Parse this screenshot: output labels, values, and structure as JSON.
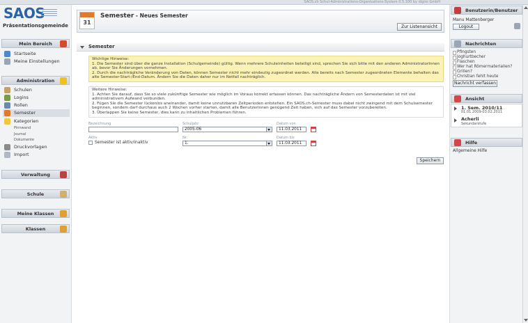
{
  "header": {
    "sysinfo": "SAOS.ch Schul-Administrations-Organisations-System 0.5.100 by digiro GmbH"
  },
  "logo": {
    "text": "SAOS",
    "school": "Präsentationsgemeinde"
  },
  "sidebar": {
    "mein_bereich": {
      "label": "Mein Bereich",
      "items": [
        "Startseite",
        "Meine Einstellungen"
      ]
    },
    "administration": {
      "label": "Administration",
      "items": [
        "Schulen",
        "Logins",
        "Rollen",
        "Semester",
        "Kategorien"
      ],
      "sub_items": [
        "Pinnwand",
        "Journal",
        "Dokumente"
      ],
      "more_items": [
        "Druckvorlagen",
        "Import"
      ]
    },
    "verwaltung": "Verwaltung",
    "schule": "Schule",
    "meine_klassen": "Meine Klassen",
    "klassen": "Klassen"
  },
  "page": {
    "calendar_icon_number": "31",
    "title": "Semester",
    "subtitle": " - Neues Semester",
    "btn_list": "Zur Listenansicht",
    "section_title": "Semester",
    "hint1": [
      "Wichtige Hinweise:",
      "1. Die Semester sind über die ganze Installation (Schulgemeinde) gültig. Wenn mehrere Schuleinheiten beteiligt sind, sprechen Sie sich bitte mit den anderen AdministratorInnen ab, bevor Sie Änderungen vornehmen.",
      "2. Durch die nachträgliche Veränderung von Daten, können Semester nicht mehr eindeutig zugeordnet werden. Alle bereits nach Semester zugeordneten Elemente behalten das alte Semester-Start-/End-Datum. Ändern Sie die Daten daher nur im Notfall nachträglich."
    ],
    "hint2": [
      "Weitere Hinweise:",
      "1. Achten Sie darauf, dass Sie so viele zukünftige Semester wie möglich im Voraus korrekt erfassen können. Das nachträgliche Ändern von Semesterdaten ist mit viel administrativem Aufwand verbunden.",
      "2. Fügen Sie die Semester lückenlos aneinander, damit keine unnutzbaren Zeitperioden entstehen. Ein SAOS.ch-Semester muss dabei nicht zwingend mit dem Schulsemester beginnen, sondern darf durchaus auch 2 Wochen vorher starten, damit alle BenutzerInnen genügend Zeit haben, sich auf das Semester vorzubereiten.",
      "3. Überlappen Sie keine Semester, dies kann zu inhaltlichen Problemen führen."
    ],
    "form": {
      "bezeichnung_label": "Bezeichnung",
      "bezeichnung_value": "",
      "schuljahr_label": "Schuljahr",
      "schuljahr_value": "2005-06",
      "datum_von_label": "Datum von",
      "datum_von_value": "11.03.2011",
      "aktiv_label": "Aktiv",
      "aktiv_text": "Semester ist aktiv/inaktiv",
      "nr_label": "Nr.",
      "nr_value": "1.",
      "datum_bis_label": "Datum bis",
      "datum_bis_value": "11.03.2011"
    },
    "btn_save": "Speichern"
  },
  "right": {
    "benutzer": {
      "label": "Benutzerin/Benutzer",
      "name": "Manu Mattenberger",
      "logout": "Logout"
    },
    "nachrichten": {
      "label": "Nachrichten",
      "items": [
        "Pfingsten",
        "Joghurtbecher",
        "Flaschen",
        "Wer hat Römermaterialien?",
        "Grillen?",
        "Christian fehlt heute"
      ],
      "button": "Nachricht verfassen"
    },
    "ansicht": {
      "label": "Ansicht",
      "sem_title": "1. Sem. 2010/11",
      "sem_dates": "01.01.2009-03.02.2011",
      "place_title": "Acherli",
      "place_sub": "Sekundarstufe"
    },
    "hilfe": {
      "label": "Hilfe",
      "text": "Allgemeine Hilfe"
    }
  },
  "colors": {
    "brand": "#2a64a8",
    "hint_bg": "#fbf2b5",
    "accent": "#e0792b"
  }
}
